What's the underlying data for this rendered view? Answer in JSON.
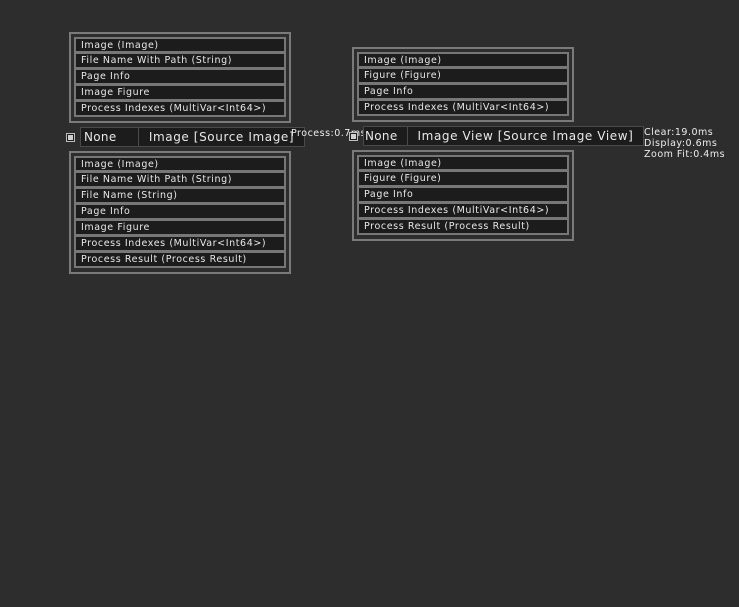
{
  "nodes": [
    {
      "none_label": "None",
      "title": "Image [Source Image]",
      "inputs": [
        "Image (Image)",
        "File Name With Path (String)",
        "Page Info",
        "Image Figure",
        "Process Indexes (MultiVar<Int64>)"
      ],
      "outputs": [
        "Image (Image)",
        "File Name With Path (String)",
        "File Name (String)",
        "Page Info",
        "Image Figure",
        "Process Indexes (MultiVar<Int64>)",
        "Process Result (Process Result)"
      ],
      "timings": [
        "Process:0.7ms"
      ]
    },
    {
      "none_label": "None",
      "title": "Image View [Source Image View]",
      "inputs": [
        "Image (Image)",
        "Figure (Figure)",
        "Page Info",
        "Process Indexes (MultiVar<Int64>)"
      ],
      "outputs": [
        "Image (Image)",
        "Figure (Figure)",
        "Page Info",
        "Process Indexes (MultiVar<Int64>)",
        "Process Result (Process Result)"
      ],
      "timings": [
        "Clear:19.0ms",
        "Display:0.6ms",
        "Zoom Fit:0.4ms"
      ]
    }
  ]
}
